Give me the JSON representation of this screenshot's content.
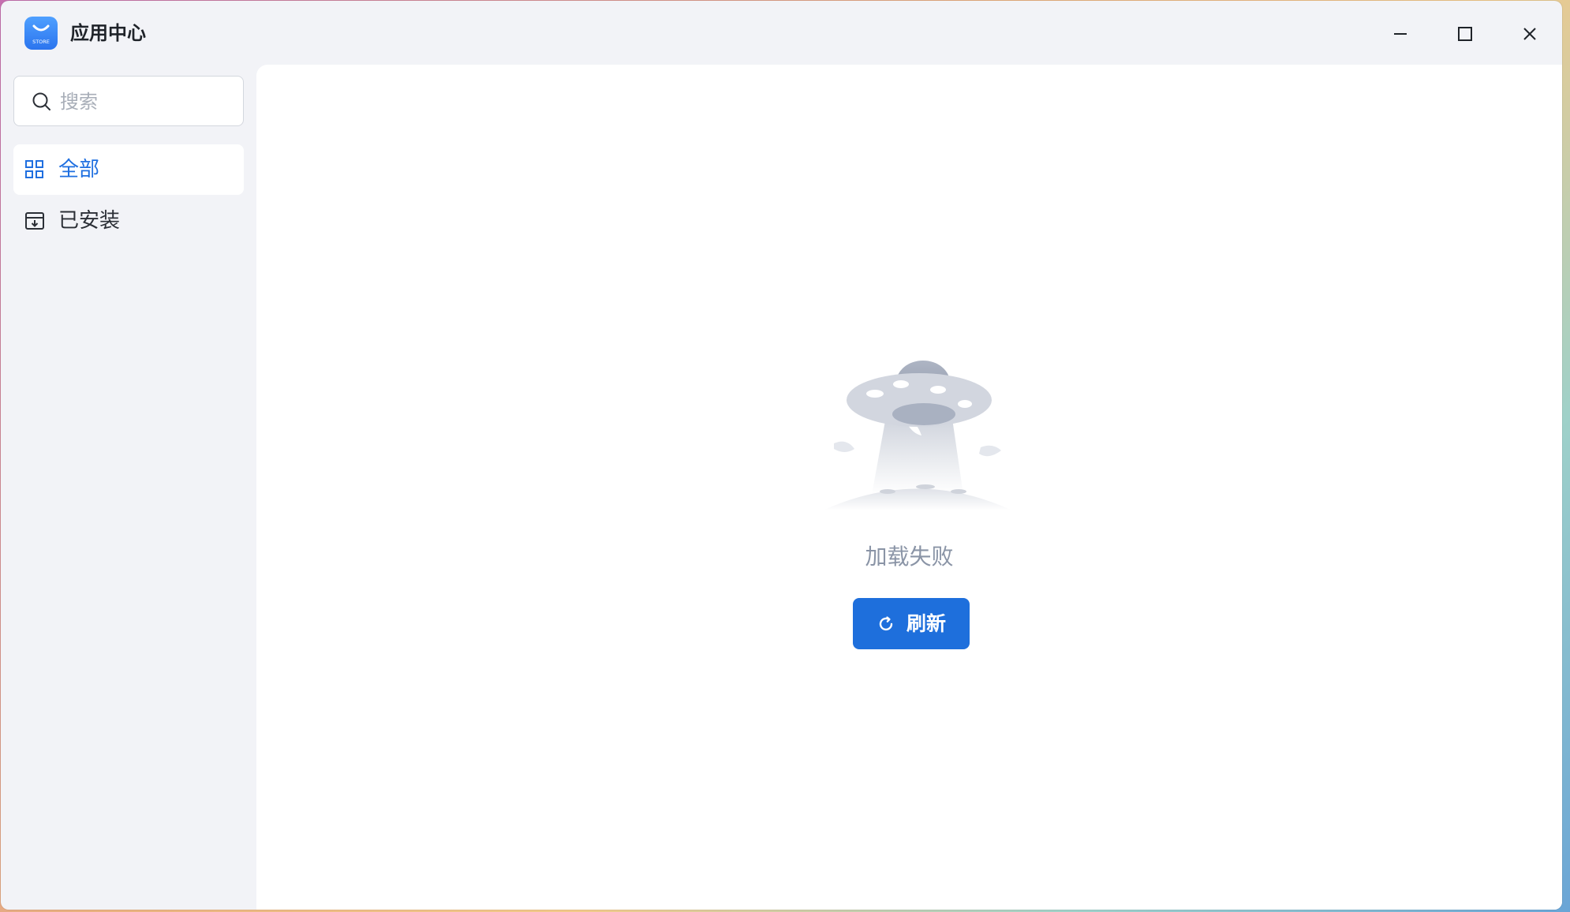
{
  "window": {
    "title": "应用中心",
    "logo_text": "STORE",
    "controls": [
      "minimize-icon",
      "maximize-icon",
      "close-icon"
    ]
  },
  "sidebar": {
    "search": {
      "placeholder": "搜索",
      "value": ""
    },
    "items": [
      {
        "label": "全部",
        "icon": "grid-icon",
        "active": true
      },
      {
        "label": "已安装",
        "icon": "installed-box-icon",
        "active": false
      }
    ]
  },
  "main": {
    "illustration": "ufo-illustration",
    "status": "加载失败",
    "refresh_label": "刷新",
    "refresh_icon": "refresh-icon"
  },
  "colors": {
    "accent": "#1e6fdc",
    "active_text": "#1f6fe0",
    "sidebar_bg": "#f2f3f7",
    "content_bg": "#ffffff",
    "status_text": "#8a94a6"
  }
}
